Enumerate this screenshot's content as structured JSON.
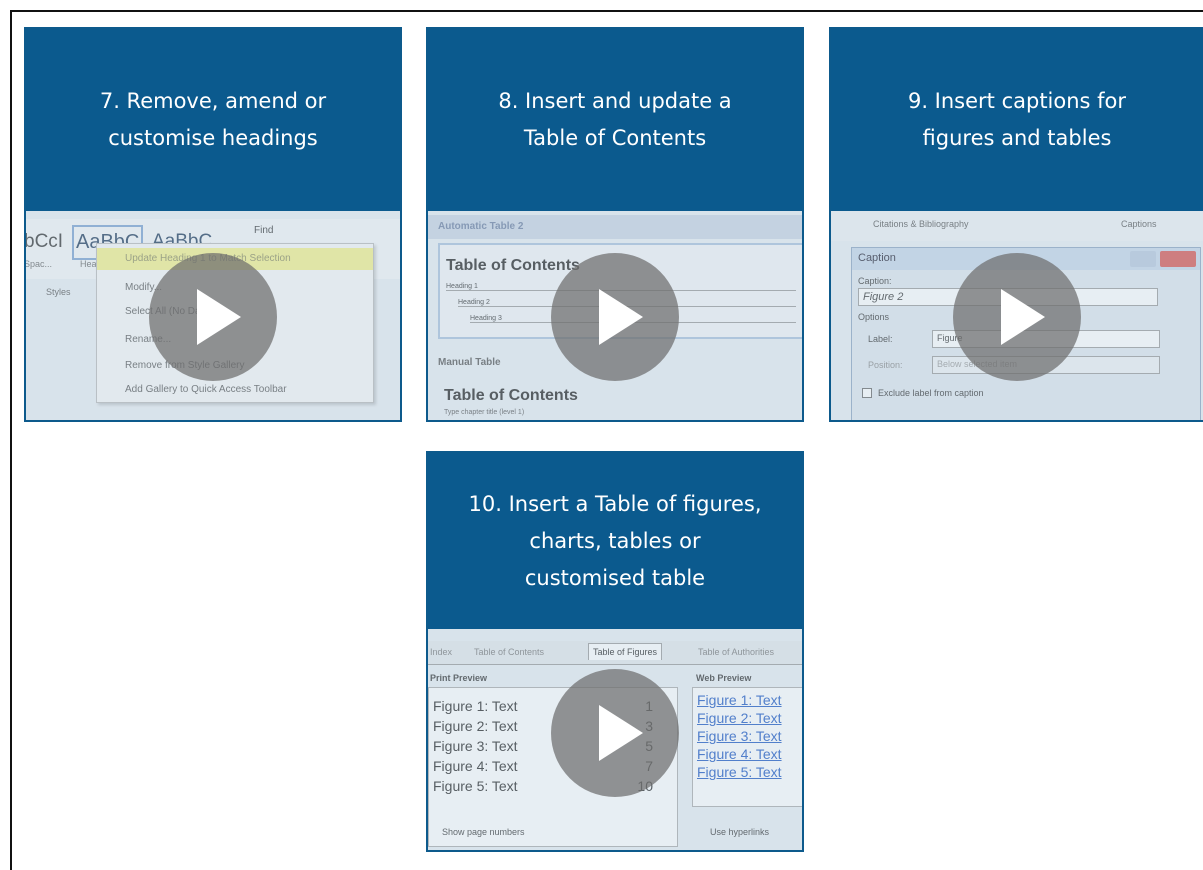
{
  "cards": [
    {
      "title": [
        "7. Remove, amend or",
        "customise headings"
      ],
      "thumb": {
        "styles": [
          "bCcI",
          "AaBbC",
          "AaBbC"
        ],
        "style_captions": [
          "Spac...",
          "Hea"
        ],
        "find": "Find",
        "styles_label": "Styles",
        "menu": [
          "Update Heading 1 to Match Selection",
          "Modify...",
          "Select All (No Data)",
          "Rename...",
          "Remove from Style Gallery",
          "Add Gallery to Quick Access Toolbar"
        ]
      }
    },
    {
      "title": [
        "8. Insert and update a",
        "Table of Contents"
      ],
      "thumb": {
        "bar": "Automatic Table 2",
        "toc_title": "Table of Contents",
        "headings": [
          "Heading 1",
          "Heading 2",
          "Heading 3"
        ],
        "manual": "Manual Table",
        "toc_title2": "Table of Contents",
        "sub2": "Type chapter title (level 1)"
      }
    },
    {
      "title": [
        "9. Insert captions for",
        "figures and tables"
      ],
      "thumb": {
        "citations": "Citations & Bibliography",
        "captions": "Captions",
        "dialog_title": "Caption",
        "caption_label": "Caption:",
        "caption_value": "Figure 2",
        "options": "Options",
        "label_label": "Label:",
        "label_value": "Figure",
        "position_label": "Position:",
        "position_value": "Below selected item",
        "exclude": "Exclude label from caption"
      }
    },
    {
      "title": [
        "10. Insert a Table of figures,",
        "charts, tables or",
        "customised table"
      ],
      "thumb": {
        "tabs": [
          "Index",
          "Table of Contents",
          "Table of Figures",
          "Table of Authorities"
        ],
        "print_preview": "Print Preview",
        "web_preview": "Web Preview",
        "rows": [
          {
            "text": "Figure 1: Text",
            "page": "1"
          },
          {
            "text": "Figure 2: Text",
            "page": "3"
          },
          {
            "text": "Figure 3: Text",
            "page": "5"
          },
          {
            "text": "Figure 4: Text",
            "page": "7"
          },
          {
            "text": "Figure 5: Text",
            "page": "10"
          }
        ],
        "links": [
          "Figure 1: Text",
          "Figure 2: Text",
          "Figure 3: Text",
          "Figure 4: Text",
          "Figure 5: Text"
        ],
        "show_page_numbers": "Show page numbers",
        "use_hyperlinks": "Use hyperlinks"
      }
    }
  ]
}
